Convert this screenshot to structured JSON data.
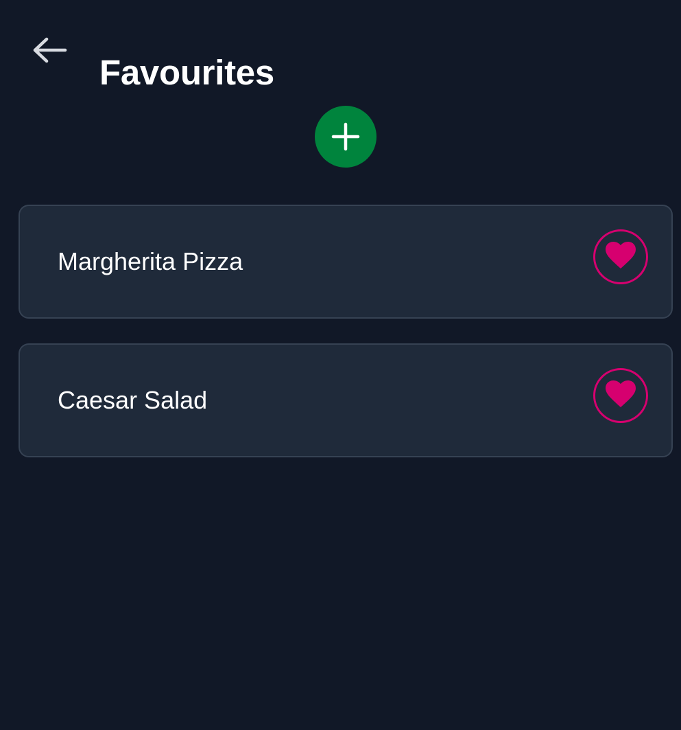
{
  "header": {
    "title": "Favourites",
    "back_icon": "arrow-left-icon"
  },
  "add_button": {
    "icon": "plus-icon",
    "color": "#00843d"
  },
  "favourites": [
    {
      "name": "Margherita Pizza",
      "favourite_icon": "heart-icon",
      "favourited": true
    },
    {
      "name": "Caesar Salad",
      "favourite_icon": "heart-icon",
      "favourited": true
    }
  ],
  "colors": {
    "background": "#111827",
    "card_background": "#1f2a3a",
    "card_border": "#364253",
    "accent_heart": "#d6006f",
    "text": "#ffffff"
  }
}
